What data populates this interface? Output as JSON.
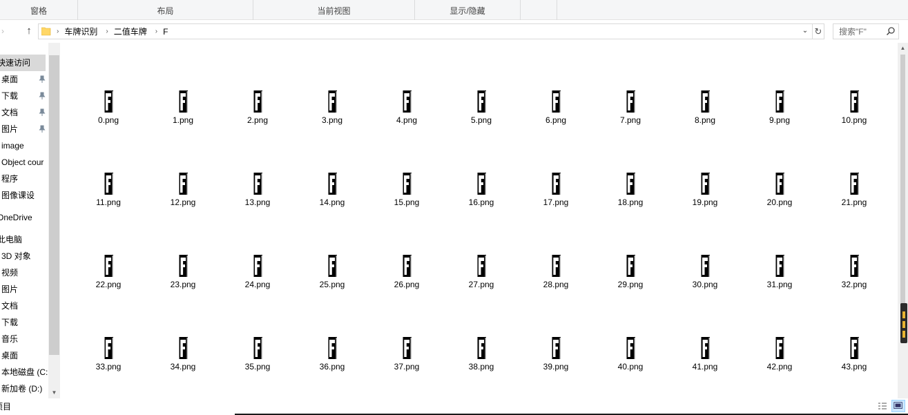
{
  "ribbon": {
    "groups": [
      "窗格",
      "布局",
      "当前视图",
      "显示/隐藏",
      ""
    ]
  },
  "nav": {
    "breadcrumbs": [
      "车牌识别",
      "二值车牌",
      "F"
    ],
    "search_placeholder": "搜索\"F\""
  },
  "sidebar": {
    "items": [
      {
        "label": "快速访问",
        "icon": "star-icon",
        "pinned": false
      },
      {
        "label": "桌面",
        "icon": "desktop-icon",
        "pinned": true
      },
      {
        "label": "下载",
        "icon": "download-icon",
        "pinned": true
      },
      {
        "label": "文档",
        "icon": "document-icon",
        "pinned": true
      },
      {
        "label": "图片",
        "icon": "picture-icon",
        "pinned": true
      },
      {
        "label": "image",
        "icon": "folder-icon",
        "pinned": false
      },
      {
        "label": "Object cour",
        "icon": "folder-icon",
        "pinned": false
      },
      {
        "label": "程序",
        "icon": "folder-icon",
        "pinned": false
      },
      {
        "label": "图像课设",
        "icon": "folder-icon",
        "pinned": false
      },
      {
        "label": "OneDrive",
        "icon": "cloud-icon",
        "pinned": false
      },
      {
        "label": "此电脑",
        "icon": "computer-icon",
        "pinned": false
      },
      {
        "label": "3D 对象",
        "icon": "cube-icon",
        "pinned": false
      },
      {
        "label": "视频",
        "icon": "video-icon",
        "pinned": false
      },
      {
        "label": "图片",
        "icon": "picture-icon",
        "pinned": false
      },
      {
        "label": "文档",
        "icon": "document-icon",
        "pinned": false
      },
      {
        "label": "下载",
        "icon": "download-icon",
        "pinned": false
      },
      {
        "label": "音乐",
        "icon": "music-icon",
        "pinned": false
      },
      {
        "label": "桌面",
        "icon": "desktop-icon",
        "pinned": false
      },
      {
        "label": "本地磁盘 (C:",
        "icon": "drive-icon",
        "pinned": false
      },
      {
        "label": "新加卷 (D:)",
        "icon": "drive-icon",
        "pinned": false
      }
    ]
  },
  "files": [
    "0.png",
    "1.png",
    "2.png",
    "3.png",
    "4.png",
    "5.png",
    "6.png",
    "7.png",
    "8.png",
    "9.png",
    "10.png",
    "11.png",
    "12.png",
    "13.png",
    "14.png",
    "15.png",
    "16.png",
    "17.png",
    "18.png",
    "19.png",
    "20.png",
    "21.png",
    "22.png",
    "23.png",
    "24.png",
    "25.png",
    "26.png",
    "27.png",
    "28.png",
    "29.png",
    "30.png",
    "31.png",
    "32.png",
    "33.png",
    "34.png",
    "35.png",
    "36.png",
    "37.png",
    "38.png",
    "39.png",
    "40.png",
    "41.png",
    "42.png",
    "43.png"
  ],
  "status": {
    "item_count": "项目"
  },
  "colors": {
    "selection": "#d9d9d9",
    "active_view": "#cce8ff",
    "folder": "#ffd766"
  }
}
